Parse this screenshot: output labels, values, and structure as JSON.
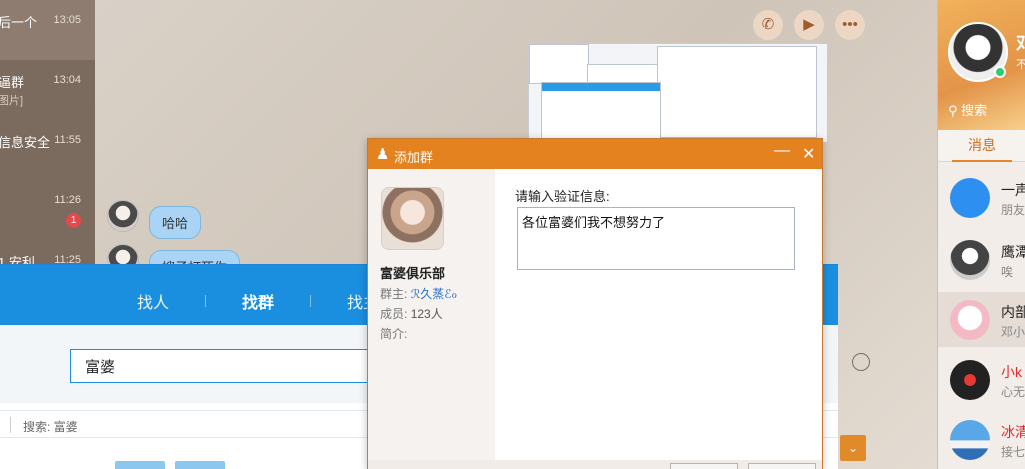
{
  "left_list": {
    "items": [
      {
        "title": "后一个",
        "sub": "",
        "time": "13:05"
      },
      {
        "title": "逼群",
        "sub": "图片]",
        "time": "13:04"
      },
      {
        "title": "信息安全",
        "sub": "",
        "time": "11:55"
      },
      {
        "title": "",
        "sub": "",
        "time": "11:26",
        "badge": "1"
      },
      {
        "title": "1 安利",
        "sub": "",
        "time": "11:25"
      }
    ]
  },
  "chat": {
    "messages": [
      {
        "text": "哈哈"
      },
      {
        "text": "嫂子打死你"
      }
    ],
    "top_icons": [
      "phone-icon",
      "video-icon",
      "more-icon"
    ]
  },
  "search_window": {
    "tabs": [
      {
        "label": "找人"
      },
      {
        "label": "找群"
      },
      {
        "label": "找主"
      }
    ],
    "query": "富婆",
    "crumb": "搜索: 富婆"
  },
  "dialog": {
    "title": "添加群",
    "group_name": "富婆俱乐部",
    "owner_label": "群主:",
    "owner_value": "ℛ久蒸ℰℴ",
    "members_label": "成员:",
    "members_value": "123人",
    "intro_label": "简介:",
    "verify_label": "请输入验证信息:",
    "verify_value": "各位富婆们我不想努力了"
  },
  "qq_panel": {
    "nickname": "邓",
    "signature": "不",
    "search_placeholder": "搜索",
    "tab_messages": "消息",
    "contacts": [
      {
        "name": "一声",
        "sub": "朋友",
        "red": false
      },
      {
        "name": "鹰潭",
        "sub": "唉",
        "red": false
      },
      {
        "name": "内部",
        "sub": "邓小",
        "red": false
      },
      {
        "name": "小k",
        "sub": "心无",
        "red": true
      },
      {
        "name": "冰清",
        "sub": "接七",
        "red": true
      }
    ]
  },
  "colors": {
    "dialog_title": "#e3821f",
    "search_blue": "#1a8fe0",
    "online_green": "#2ecc71"
  }
}
